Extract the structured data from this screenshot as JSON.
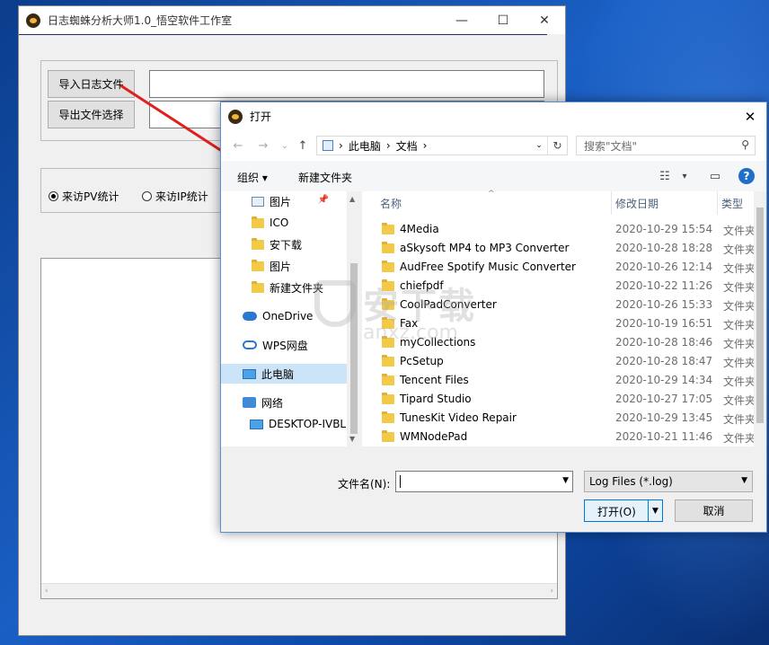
{
  "app": {
    "title": "日志蜘蛛分析大师1.0_悟空软件工作室",
    "controls": {
      "minimize": "—",
      "maximize": "☐",
      "close": "✕"
    },
    "import_button": "导入日志文件",
    "export_button": "导出文件选择",
    "radio_pv": "来访PV统计",
    "radio_ip": "来访IP统计",
    "radio_pv_selected": true
  },
  "dialog": {
    "title": "打开",
    "close": "✕",
    "nav": {
      "back": "←",
      "forward": "→",
      "recent": "⌄",
      "up": "↑"
    },
    "address": {
      "sep1": "›",
      "part1": "此电脑",
      "sep2": "›",
      "part2": "文档",
      "sep3": "›",
      "drop": "⌄",
      "refresh": "↻"
    },
    "search_placeholder": "搜索\"文档\"",
    "search_icon": "⚲",
    "organize": "组织 ▾",
    "new_folder": "新建文件夹",
    "view_icon": "☷",
    "view_drop": "▾",
    "pane_icon": "▭",
    "help": "?",
    "nav_items": [
      {
        "label": "图片",
        "icon": "pictures-icon",
        "pinned": true
      },
      {
        "label": "ICO",
        "icon": "folder-icon"
      },
      {
        "label": "安下载",
        "icon": "folder-icon"
      },
      {
        "label": "图片",
        "icon": "folder-icon"
      },
      {
        "label": "新建文件夹",
        "icon": "folder-icon"
      },
      {
        "label": "OneDrive",
        "icon": "onedrive-icon"
      },
      {
        "label": "WPS网盘",
        "icon": "wps-cloud-icon"
      },
      {
        "label": "此电脑",
        "icon": "this-pc-icon",
        "selected": true
      },
      {
        "label": "网络",
        "icon": "network-icon"
      },
      {
        "label": "DESKTOP-IVBL",
        "icon": "computer-icon"
      }
    ],
    "pin_glyph": "📌",
    "columns": {
      "name": "名称",
      "modified": "修改日期",
      "type": "类型"
    },
    "files": [
      {
        "name": "4Media",
        "modified": "2020-10-29 15:54",
        "type": "文件夹"
      },
      {
        "name": "aSkysoft MP4 to MP3 Converter",
        "modified": "2020-10-28 18:28",
        "type": "文件夹"
      },
      {
        "name": "AudFree Spotify Music Converter",
        "modified": "2020-10-26 12:14",
        "type": "文件夹"
      },
      {
        "name": "chiefpdf",
        "modified": "2020-10-22 11:26",
        "type": "文件夹"
      },
      {
        "name": "CoolPadConverter",
        "modified": "2020-10-26 15:33",
        "type": "文件夹"
      },
      {
        "name": "Fax",
        "modified": "2020-10-19 16:51",
        "type": "文件夹"
      },
      {
        "name": "myCollections",
        "modified": "2020-10-28 18:46",
        "type": "文件夹"
      },
      {
        "name": "PcSetup",
        "modified": "2020-10-28 18:47",
        "type": "文件夹"
      },
      {
        "name": "Tencent Files",
        "modified": "2020-10-29 14:34",
        "type": "文件夹"
      },
      {
        "name": "Tipard Studio",
        "modified": "2020-10-27 17:05",
        "type": "文件夹"
      },
      {
        "name": "TunesKit Video Repair",
        "modified": "2020-10-29 13:45",
        "type": "文件夹"
      },
      {
        "name": "WMNodePad",
        "modified": "2020-10-21 11:46",
        "type": "文件夹"
      }
    ],
    "filename_label": "文件名(N):",
    "filename_value": "",
    "filetype_value": "Log Files (*.log)",
    "open_button": "打开(O)",
    "cancel_button": "取消"
  },
  "watermark": {
    "main": "安下载",
    "sub": "anxz.com"
  }
}
